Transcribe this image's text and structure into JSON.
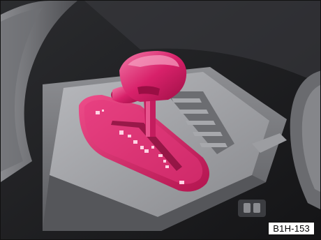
{
  "figure": {
    "label": "B1H-153",
    "highlight_color": "#d8216a",
    "subject": "automatic-gearbox-selector-lever"
  }
}
